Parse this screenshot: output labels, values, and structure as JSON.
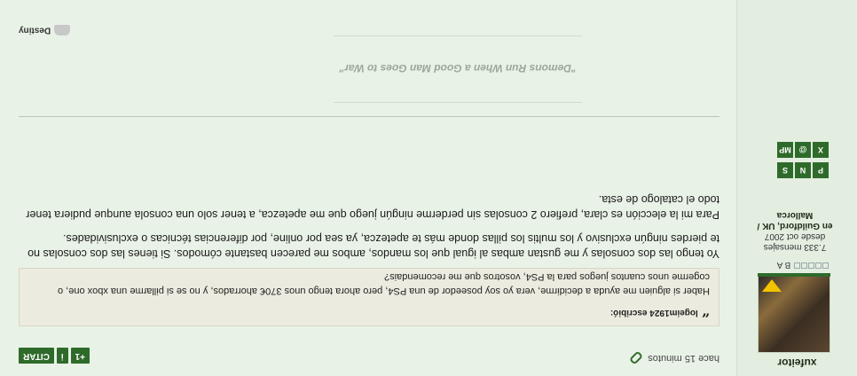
{
  "user": {
    "name": "xufeitor",
    "rank_label": "B A",
    "posts": "7.333 mensajes",
    "joined": "desde oct 2007",
    "location_line1": "en Guildford, UK /",
    "location_line2": "Mallorca",
    "icons": [
      "PSN",
      "nintendo",
      "steam",
      "xbox",
      "origin",
      "MP"
    ]
  },
  "post": {
    "time": "hace 15 minutos",
    "buttons": {
      "plus_one": "+1",
      "info": "i",
      "quote": "CITAR"
    },
    "quote": {
      "author_line": "logeim1924 escribió:",
      "text": "Haber si alguien me ayuda a decidirme, vera yo soy poseedor de una PS4, pero ahora tengo unos 370€ ahorrados, y no se si pillarme una xbox one, o cogerme unos cuantos juegos para la PS4, vosotros que me recomendais?"
    },
    "paragraphs": [
      "Yo tengo las dos consolas y me gustan ambas al igual que los mandos, ambos me parecen bastante cómodos. Si tienes las dos consolas no te pierdes ningún exclusivo y los multis los pillas donde más te apetezca, ya sea por online, por diferencias técnicas o exclusividades.",
      "Para mi la elección es clara, prefiero 2 consolas sin perderme ningún juego que me apetezca, a tener solo una consola aunque pudiera tener todo el catalogo de esta."
    ],
    "signature": "\"Demons Run When a Good Man Goes to War\"",
    "destiny_label": "Destiny"
  }
}
